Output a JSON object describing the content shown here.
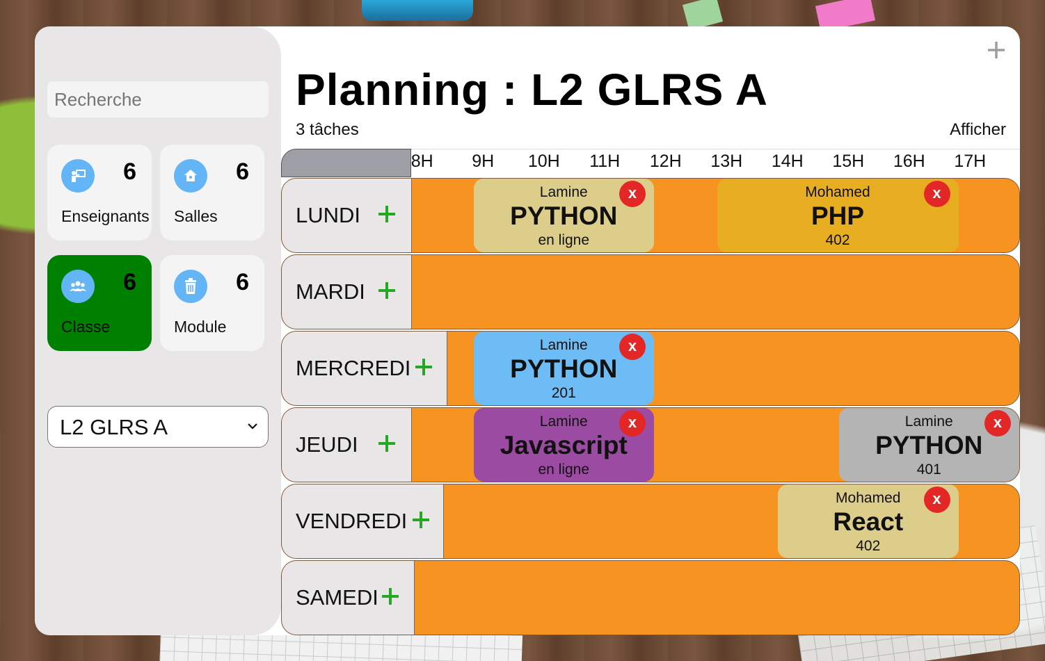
{
  "search": {
    "placeholder": "Recherche"
  },
  "cards": [
    {
      "label": "Enseignants",
      "count": "6",
      "icon": "teacher-icon"
    },
    {
      "label": "Salles",
      "count": "6",
      "icon": "home-icon"
    },
    {
      "label": "Classe",
      "count": "6",
      "icon": "group-icon"
    },
    {
      "label": "Module",
      "count": "6",
      "icon": "trash-icon"
    }
  ],
  "class_select": {
    "value": "L2 GLRS A"
  },
  "header": {
    "title": "Planning : L2 GLRS A",
    "task_count": "3 tâches",
    "show_label": "Afficher"
  },
  "hours": [
    "8H",
    "9H",
    "10H",
    "11H",
    "12H",
    "13H",
    "14H",
    "15H",
    "16H",
    "17H"
  ],
  "days": [
    {
      "label": "LUNDI"
    },
    {
      "label": "MARDI"
    },
    {
      "label": "MERCREDI"
    },
    {
      "label": "JEUDI"
    },
    {
      "label": "VENDREDI"
    },
    {
      "label": "SAMEDI"
    }
  ],
  "tasks": [
    {
      "day": "LUNDI",
      "teacher": "Lamine",
      "module": "PYTHON",
      "room": "en ligne",
      "start": "9H",
      "end": "12H",
      "color": "#dccd8a"
    },
    {
      "day": "LUNDI",
      "teacher": "Mohamed",
      "module": "PHP",
      "room": "402",
      "start": "13H",
      "end": "17H",
      "color": "#e8ae22"
    },
    {
      "day": "MERCREDI",
      "teacher": "Lamine",
      "module": "PYTHON",
      "room": "201",
      "start": "9H",
      "end": "12H",
      "color": "#6ebcf5"
    },
    {
      "day": "JEUDI",
      "teacher": "Lamine",
      "module": "Javascript",
      "room": "en ligne",
      "start": "9H",
      "end": "12H",
      "color": "#9b4ba2"
    },
    {
      "day": "JEUDI",
      "teacher": "Lamine",
      "module": "PYTHON",
      "room": "401",
      "start": "15H",
      "end": "18H",
      "color": "#b4b4b4"
    },
    {
      "day": "VENDREDI",
      "teacher": "Mohamed",
      "module": "React",
      "room": "402",
      "start": "14H",
      "end": "17H",
      "color": "#dccd8a"
    }
  ],
  "delete_label": "x",
  "colors": {
    "accent_active": "#008000",
    "row": "#f79421",
    "delete": "#e32626",
    "icon_bg": "#64b5f6",
    "add": "#22a822"
  }
}
